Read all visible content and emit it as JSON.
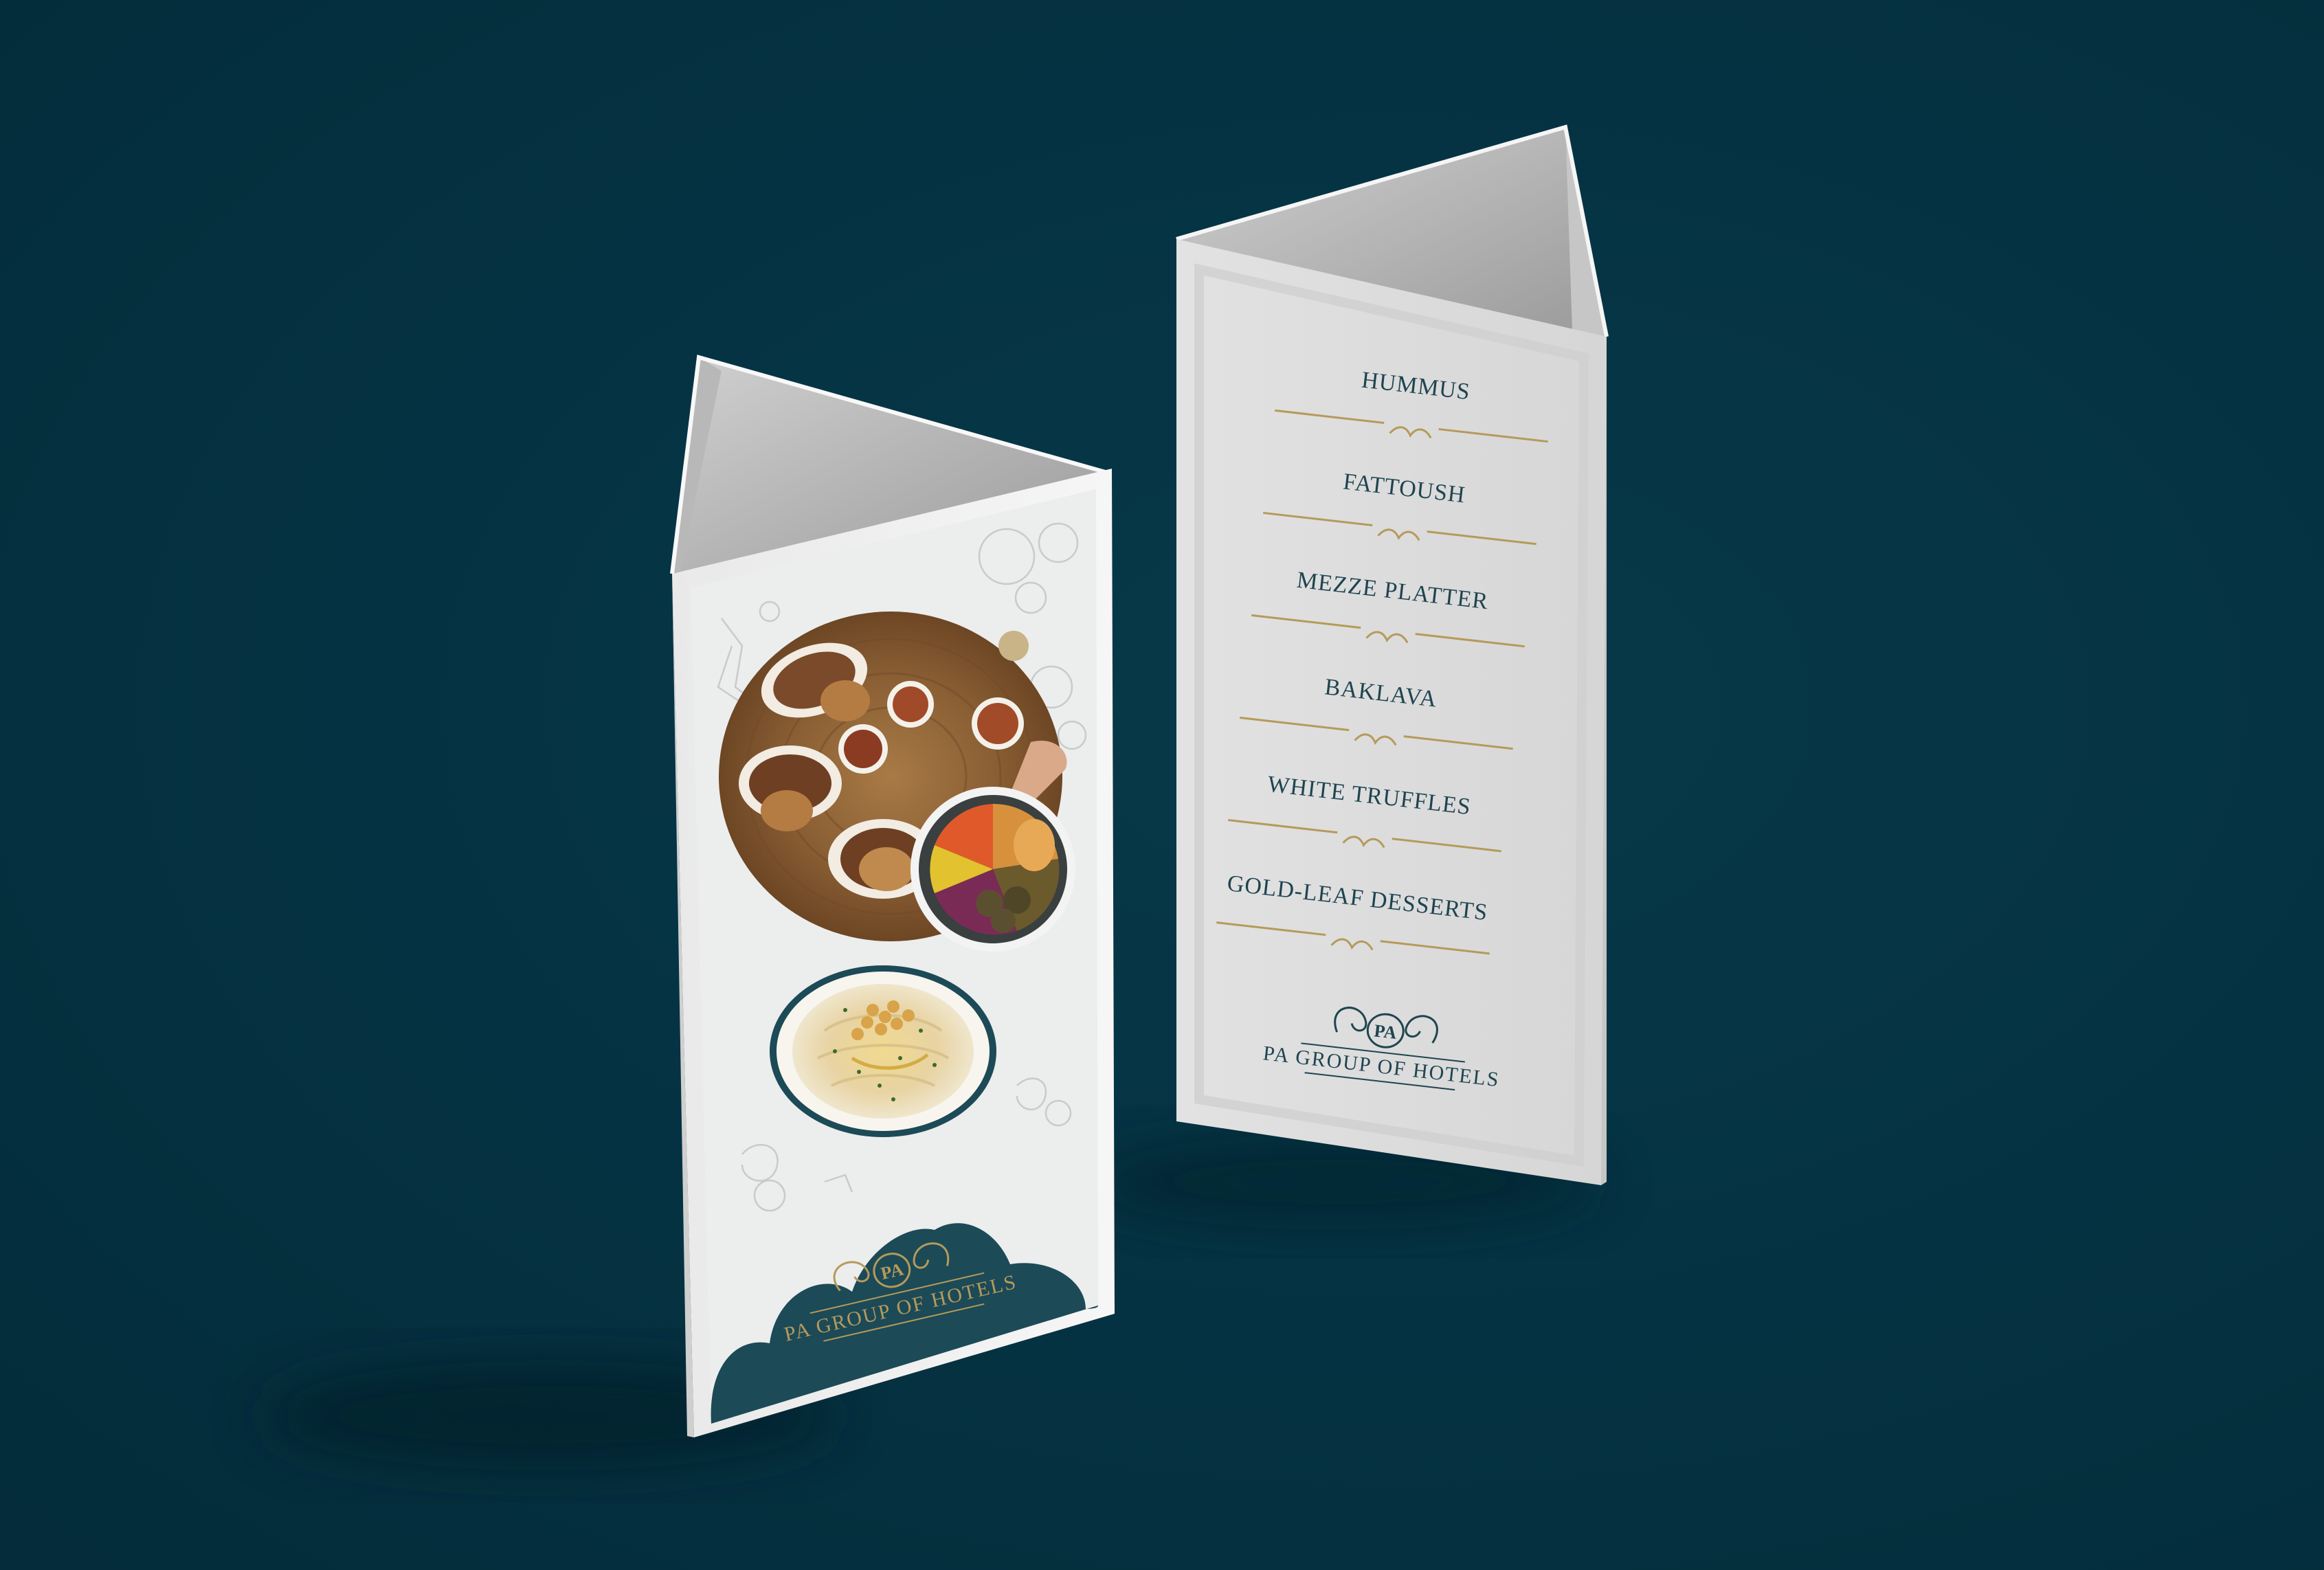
{
  "scene": {
    "background_color": "#053343",
    "card_color": "#f1f1f1",
    "accent_gold": "#b59a5a",
    "accent_teal": "#1c4a57"
  },
  "front_card": {
    "brand": {
      "monogram": "PA",
      "name": "PA GROUP OF HOTELS"
    },
    "photos": [
      "mezze-platter-photo",
      "falafel-bowl-photo",
      "hummus-bowl-photo"
    ]
  },
  "back_card": {
    "menu_items": [
      "HUMMUS",
      "FATTOUSH",
      "MEZZE PLATTER",
      "BAKLAVA",
      "WHITE TRUFFLES",
      "GOLD-LEAF DESSERTS"
    ],
    "brand": {
      "monogram": "PA",
      "name": "PA GROUP OF HOTELS"
    }
  }
}
